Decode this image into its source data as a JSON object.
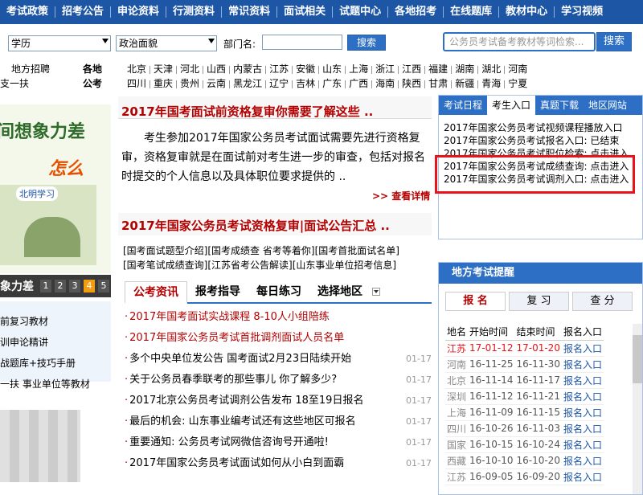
{
  "topnav": [
    "考试政策",
    "招考公告",
    "申论资料",
    "行测资料",
    "常识资料",
    "面试相关",
    "试题中心",
    "各地招考",
    "在线题库",
    "教材中心",
    "学习视频"
  ],
  "search": {
    "edu": "学历",
    "politics": "政治面貌",
    "dept_label": "部门名:",
    "dept_value": "",
    "btn": "搜索",
    "placeholder": "公务员考试备考教材等词检索...",
    "btn2": "搜索"
  },
  "regions": {
    "left": [
      "地方招聘",
      "支一扶"
    ],
    "col_label1": "各地",
    "col_label2": "公考",
    "row1": [
      "北京",
      "天津",
      "河北",
      "山西",
      "内蒙古",
      "江苏",
      "安徽",
      "山东",
      "上海",
      "浙江",
      "江西",
      "福建",
      "湖南",
      "湖北",
      "河南"
    ],
    "row2": [
      "四川",
      "重庆",
      "贵州",
      "云南",
      "黑龙江",
      "辽宁",
      "吉林",
      "广东",
      "广西",
      "海南",
      "陕西",
      "甘肃",
      "新疆",
      "青海",
      "宁夏"
    ]
  },
  "leftad": {
    "line1": "间想象力差",
    "line2": "怎么办?",
    "brand": "北明学习"
  },
  "leftslide": {
    "label": "象力差",
    "nums": [
      "1",
      "2",
      "3",
      "4",
      "5"
    ]
  },
  "leftlinks": [
    "前复习教材",
    "训申论精讲",
    "战题库+技巧手册",
    "一扶 事业单位等教材"
  ],
  "main": {
    "headline1": "2017年国考面试前资格复审你需要了解这些 ..",
    "para": "考生参加2017年国家公务员考试面试需要先进行资格复审，资格复审就是在面试前对考生进一步的审查，包括对报名时提交的个人信息以及具体职位要求提供的 ..",
    "more": ">> 查看详情",
    "headline2": "2017年国家公务员考试资格复审|面试公告汇总 ..",
    "links_row1": [
      "[国考面试题型介绍]",
      "[国考成绩查 省考等着你]",
      "[国考首批面试名单]"
    ],
    "links_row2": [
      "[国考笔试成绩查询]",
      "[江苏省考公告解读]",
      "[山东事业单位招考信息]"
    ],
    "tabs": [
      "公考资讯",
      "报考指导",
      "每日练习",
      "选择地区"
    ],
    "news": [
      {
        "t": "2017年国考面试实战课程 8-10人小组陪练",
        "d": "",
        "red": true
      },
      {
        "t": "2017年国家公务员考试首批调剂面试人员名单",
        "d": "",
        "red": true
      },
      {
        "t": "多个中央单位发公告 国考面试2月23日陆续开始",
        "d": "01-17",
        "red": false
      },
      {
        "t": "关于公务员春季联考的那些事儿 你了解多少?",
        "d": "01-17",
        "red": false
      },
      {
        "t": "2017北京公务员考试调剂公告发布 18至19日报名",
        "d": "01-17",
        "red": false
      },
      {
        "t": "最后的机会: 山东事业编考试还有这些地区可报名",
        "d": "01-17",
        "red": false
      },
      {
        "t": "重要通知: 公务员考试网微信咨询号开通啦!",
        "d": "01-17",
        "red": false
      },
      {
        "t": "2017年国家公务员考试面试如何从小白到面霸",
        "d": "01-17",
        "red": false
      }
    ]
  },
  "right": {
    "tabs": [
      "考试日程",
      "考生入口",
      "真题下载",
      "地区网站"
    ],
    "items": [
      "2017年国家公务员考试视频课程播放入口",
      "2017年国家公务员考试报名入口: 已结束",
      "2017年国家公务员考试职位检索: 点击进入",
      "2017年国家公务员考试成绩查询: 点击进入",
      "2017年国家公务员考试调剂入口: 点击进入"
    ],
    "remind_title": "地方考试提醒",
    "remind_tabs": [
      "报 名",
      "复 习",
      "查 分"
    ],
    "table_head": [
      "地名",
      "开始时间",
      "结束时间",
      "报名入口"
    ],
    "rows": [
      {
        "name": "江苏",
        "start": "17-01-12",
        "end": "17-01-20",
        "link": "报名入口",
        "red": true
      },
      {
        "name": "河南",
        "start": "16-11-25",
        "end": "16-11-30",
        "link": "报名入口",
        "red": false
      },
      {
        "name": "北京",
        "start": "16-11-14",
        "end": "16-11-17",
        "link": "报名入口",
        "red": false
      },
      {
        "name": "深圳",
        "start": "16-11-12",
        "end": "16-11-21",
        "link": "报名入口",
        "red": false
      },
      {
        "name": "上海",
        "start": "16-11-09",
        "end": "16-11-15",
        "link": "报名入口",
        "red": false
      },
      {
        "name": "四川",
        "start": "16-10-26",
        "end": "16-11-03",
        "link": "报名入口",
        "red": false
      },
      {
        "name": "国家",
        "start": "16-10-15",
        "end": "16-10-24",
        "link": "报名入口",
        "red": false
      },
      {
        "name": "西藏",
        "start": "16-10-10",
        "end": "16-10-20",
        "link": "报名入口",
        "red": false
      },
      {
        "name": "江苏",
        "start": "16-09-05",
        "end": "16-09-20",
        "link": "报名入口",
        "red": false
      }
    ]
  },
  "colors": {
    "nav": "#1e56a6",
    "accent": "#b30000",
    "highlight": "#e8141a"
  }
}
